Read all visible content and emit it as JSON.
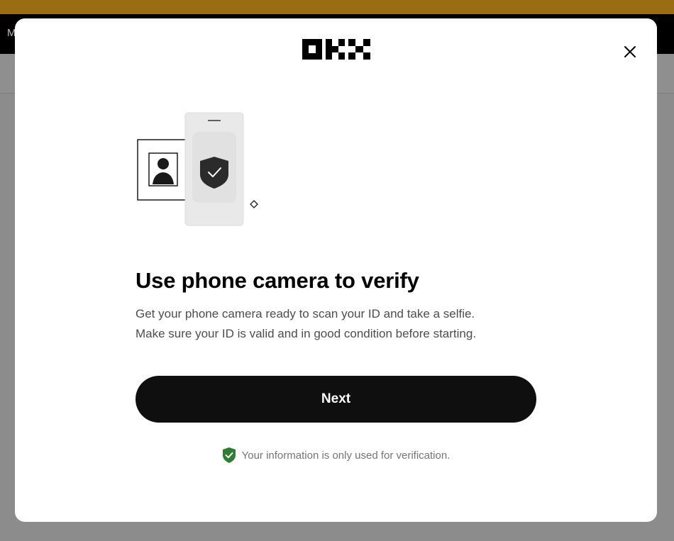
{
  "background": {
    "nav_text": "M"
  },
  "modal": {
    "logo_name": "okx-logo",
    "close_icon": "close-icon",
    "illustration": "phone-camera-verification-illustration",
    "title": "Use phone camera to verify",
    "description_line1": "Get your phone camera ready to scan your ID and take a selfie.",
    "description_line2": "Make sure your ID is valid and in good condition before starting.",
    "next_label": "Next",
    "privacy_text": "Your information is only used for verification.",
    "privacy_icon_color": "#2e7d32"
  },
  "colors": {
    "banner": "#9a6d12",
    "button": "#0f0f0f"
  }
}
